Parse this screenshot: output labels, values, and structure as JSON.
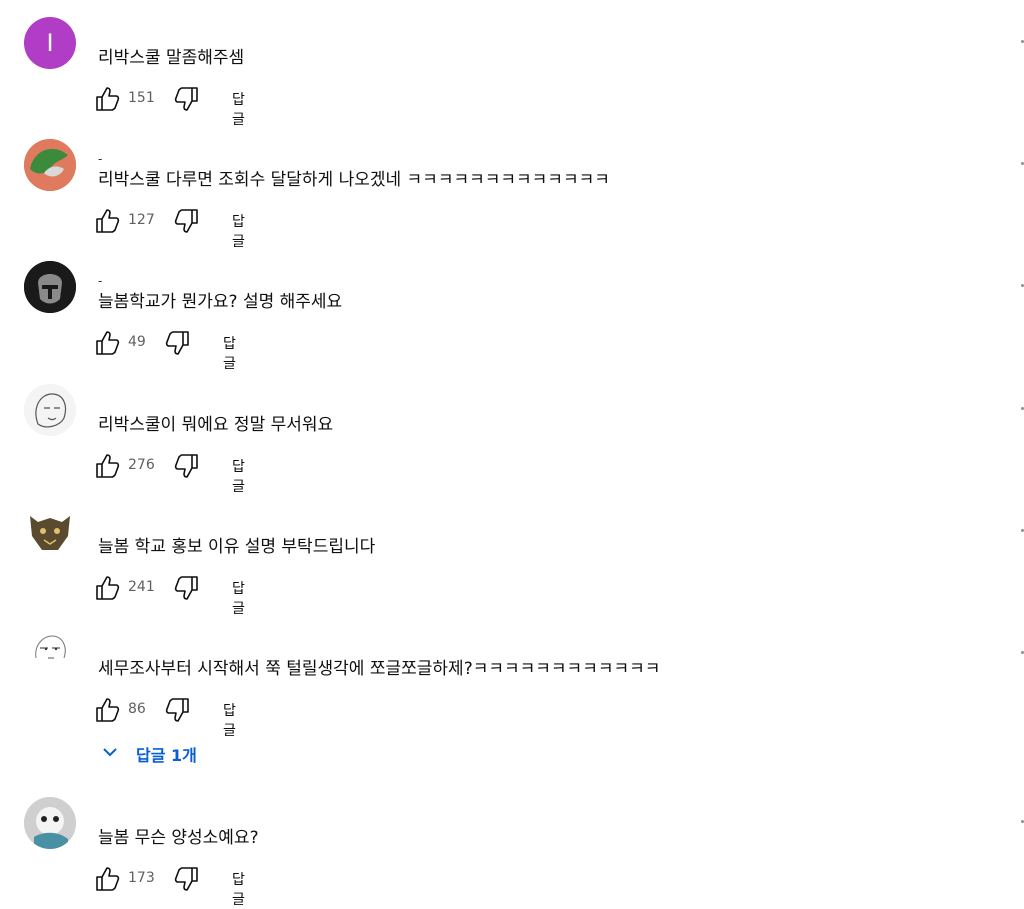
{
  "comments": [
    {
      "author": "",
      "text": "리박스쿨 말좀해주셈",
      "likes": "151",
      "reply": "답글",
      "avatar_letter": "I",
      "avatar_color": "#b13dc6"
    },
    {
      "author": "-",
      "text": "리박스쿨 다루면 조회수 달달하게 나오겠네 ㅋㅋㅋㅋㅋㅋㅋㅋㅋㅋㅋㅋㅋ",
      "likes": "127",
      "reply": "답글"
    },
    {
      "author": "-",
      "text": "늘봄학교가 뭔가요? 설명 해주세요",
      "likes": "49",
      "reply": "답글"
    },
    {
      "author": "",
      "text": "리박스쿨이 뭐에요 정말 무서워요",
      "likes": "276",
      "reply": "답글"
    },
    {
      "author": "",
      "text": "늘봄 학교 홍보 이유 설명 부탁드립니다",
      "likes": "241",
      "reply": "답글"
    },
    {
      "author": "",
      "text": "세무조사부터 시작해서 쭉 털릴생각에 쪼글쪼글하제?ㅋㅋㅋㅋㅋㅋㅋㅋㅋㅋㅋㅋ",
      "likes": "86",
      "reply": "답글",
      "replies_label": "답글 1개"
    },
    {
      "author": "",
      "text": "늘봄 무슨 양성소예요?",
      "likes": "173",
      "reply": "답글"
    }
  ],
  "colors": {
    "link": "#065fd4",
    "muted": "#606060"
  },
  "icons": [
    "thumbs-up-icon",
    "thumbs-down-icon",
    "chevron-down-icon"
  ]
}
